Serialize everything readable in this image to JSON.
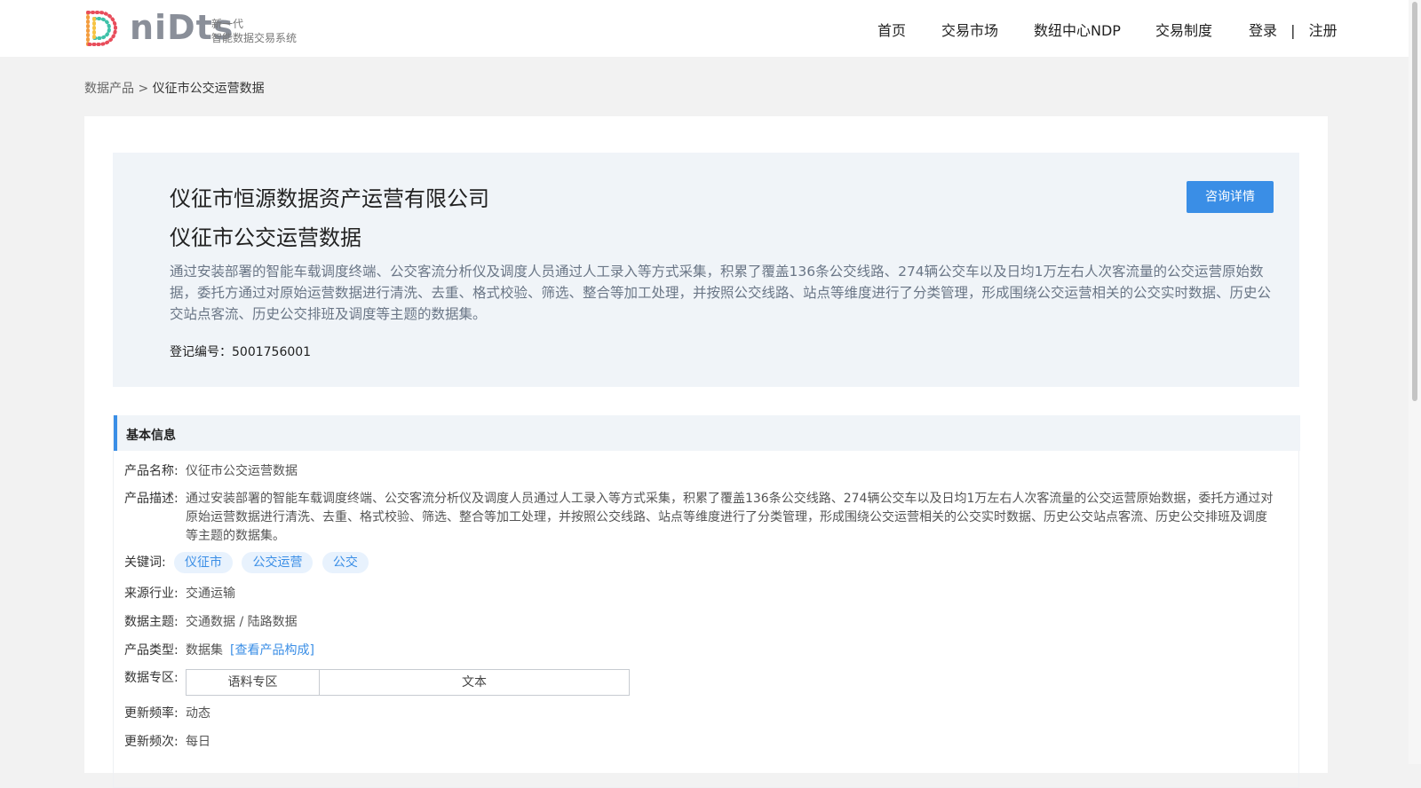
{
  "header": {
    "logo_text": "niDts",
    "logo_sub_line1": "新一代",
    "logo_sub_line2": "智能数据交易系统",
    "nav": [
      "首页",
      "交易市场",
      "数纽中心NDP",
      "交易制度"
    ],
    "login": "登录",
    "separator": "|",
    "register": "注册"
  },
  "breadcrumb": {
    "parent": "数据产品",
    "separator": ">",
    "current": "仪征市公交运营数据"
  },
  "hero": {
    "company": "仪征市恒源数据资产运营有限公司",
    "title": "仪征市公交运营数据",
    "description": "通过安装部署的智能车载调度终端、公交客流分析仪及调度人员通过人工录入等方式采集，积累了覆盖136条公交线路、274辆公交车以及日均1万左右人次客流量的公交运营原始数据，委托方通过对原始运营数据进行清洗、去重、格式校验、筛选、整合等加工处理，并按照公交线路、站点等维度进行了分类管理，形成围绕公交运营相关的公交实时数据、历史公交站点客流、历史公交排班及调度等主题的数据集。",
    "registration": "登记编号：5001756001",
    "consult_button": "咨询详情"
  },
  "basic_info": {
    "title": "基本信息",
    "product_name_label": "产品名称:",
    "product_name": "仪征市公交运营数据",
    "description_label": "产品描述:",
    "description": "通过安装部署的智能车载调度终端、公交客流分析仪及调度人员通过人工录入等方式采集，积累了覆盖136条公交线路、274辆公交车以及日均1万左右人次客流量的公交运营原始数据，委托方通过对原始运营数据进行清洗、去重、格式校验、筛选、整合等加工处理，并按照公交线路、站点等维度进行了分类管理，形成围绕公交运营相关的公交实时数据、历史公交站点客流、历史公交排班及调度等主题的数据集。",
    "keywords_label": "关键词:",
    "keywords": [
      "仪征市",
      "公交运营",
      "公交"
    ],
    "industry_label": "来源行业:",
    "industry": "交通运输",
    "theme_label": "数据主题:",
    "theme": "交通数据 / 陆路数据",
    "type_label": "产品类型:",
    "type": "数据集",
    "type_link": "[查看产品构成]",
    "zone_label": "数据专区:",
    "zone": [
      "语料专区",
      "文本"
    ],
    "update_freq_label": "更新频率:",
    "update_freq": "动态",
    "update_times_label": "更新频次:",
    "update_times": "每日"
  }
}
